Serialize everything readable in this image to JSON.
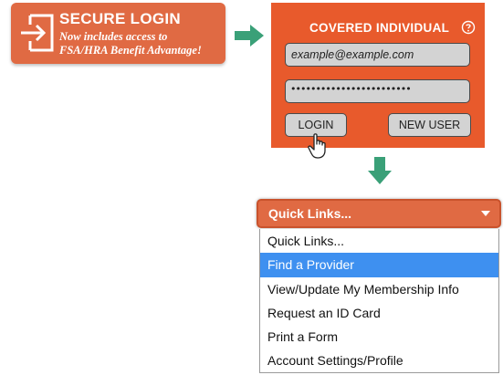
{
  "secure_login": {
    "title": "SECURE LOGIN",
    "subtitle_line1": "Now includes access to",
    "subtitle_line2": "FSA/HRA Benefit Advantage!",
    "icon": "login-door-icon"
  },
  "login_panel": {
    "title": "COVERED INDIVIDUAL",
    "help_icon": "help-circle-icon",
    "email_value": "example@example.com",
    "password_value": "••••••••••••••••••••••••",
    "login_label": "LOGIN",
    "new_user_label": "NEW USER"
  },
  "quick_links": {
    "selected_label": "Quick Links...",
    "options": [
      "Quick Links...",
      "Find a Provider",
      "View/Update My Membership Info",
      "Request an ID Card",
      "Print a Form",
      "Account Settings/Profile"
    ],
    "highlighted_index": 1
  },
  "colors": {
    "brand_orange": "#e85a2c",
    "banner_orange": "#e06a43",
    "arrow_green": "#3aa078",
    "highlight_blue": "#3e90f0"
  }
}
